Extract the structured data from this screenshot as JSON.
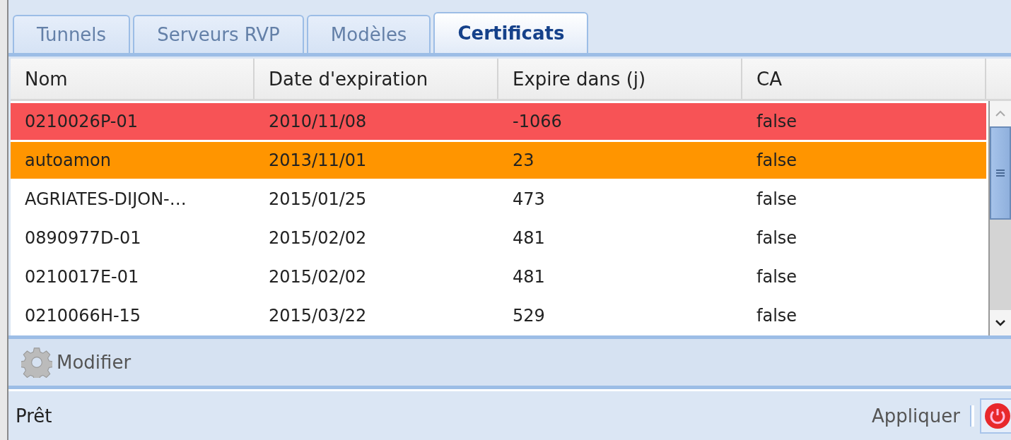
{
  "tabs": [
    {
      "label": "Tunnels",
      "selected": false
    },
    {
      "label": "Serveurs RVP",
      "selected": false
    },
    {
      "label": "Modèles",
      "selected": false
    },
    {
      "label": "Certificats",
      "selected": true
    }
  ],
  "table": {
    "columns": [
      "Nom",
      "Date d'expiration",
      "Expire dans (j)",
      "CA"
    ],
    "rows": [
      {
        "cells": [
          "0210026P-01",
          "2010/11/08",
          "-1066",
          "false"
        ],
        "color": "#f75356"
      },
      {
        "cells": [
          "autoamon",
          "2013/11/01",
          "23",
          "false"
        ],
        "color": "#ff9500"
      },
      {
        "cells": [
          "AGRIATES-DIJON-…",
          "2015/01/25",
          "473",
          "false"
        ],
        "color": "#ffffff"
      },
      {
        "cells": [
          "0890977D-01",
          "2015/02/02",
          "481",
          "false"
        ],
        "color": "#ffffff"
      },
      {
        "cells": [
          "0210017E-01",
          "2015/02/02",
          "481",
          "false"
        ],
        "color": "#ffffff"
      },
      {
        "cells": [
          "0210066H-15",
          "2015/03/22",
          "529",
          "false"
        ],
        "color": "#ffffff"
      }
    ]
  },
  "toolbar": {
    "modify_button": "Modifier"
  },
  "status_bar": {
    "status": "Prêt",
    "apply_button": "Appliquer"
  }
}
